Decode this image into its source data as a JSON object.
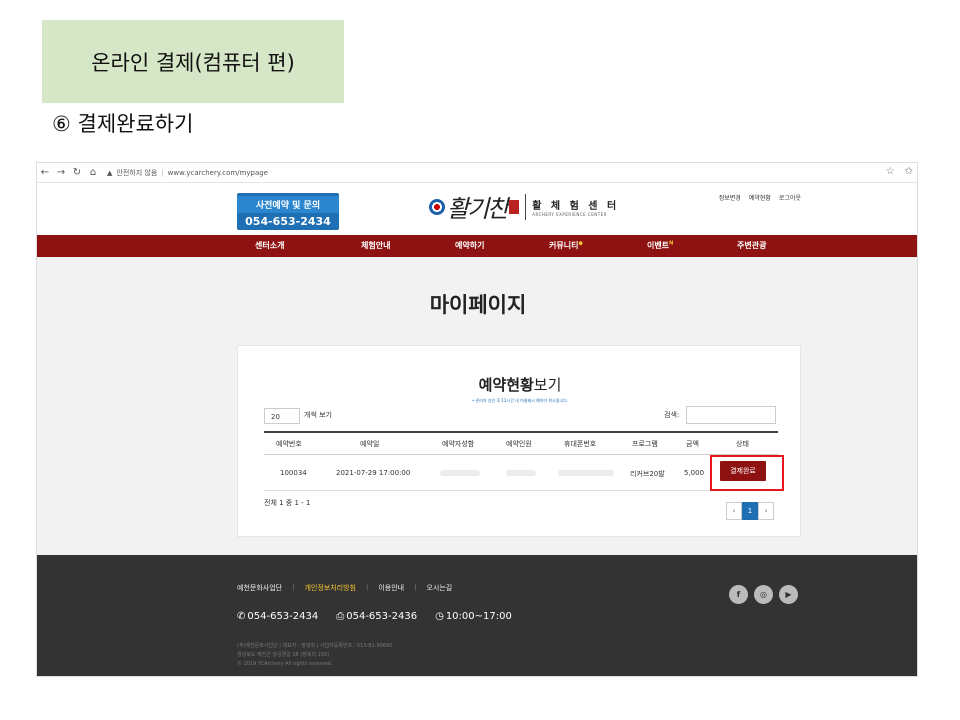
{
  "slide": {
    "title": "온라인 결제(컴퓨터 편)",
    "step": "⑥ 결제완료하기"
  },
  "browser": {
    "security": "안전하지 않음",
    "url": "www.ycarchery.com/mypage"
  },
  "header": {
    "contact_title": "사전예약 및 문의",
    "contact_phone": "054-653-2434",
    "logo_script": "활기찬",
    "brand_name": "활 체 험 센 터",
    "brand_sub": "ARCHERY EXPERIENCE CENTER",
    "links": [
      "정보변경",
      "예약현황",
      "로그아웃"
    ]
  },
  "menu": [
    "센터소개",
    "체험안내",
    "예약하기",
    "커뮤니티",
    "이벤트",
    "주변관광"
  ],
  "page_title": "마이페이지",
  "reservations": {
    "title_bold": "예약현황",
    "title_rest": "보기",
    "note": "• 관리자 승인 후 12시간 내 미결제시 예약이 취소됩니다.",
    "per_page": "20",
    "per_page_label": "개씩 보기",
    "search_label": "검색:",
    "columns": [
      "예약번호",
      "예약일",
      "예약자성함",
      "예약인원",
      "휴대폰번호",
      "프로그램",
      "금액",
      "상태"
    ],
    "rows": [
      {
        "id": "100034",
        "date": "2021-07-29 17:00:00",
        "program": "리커브20발",
        "amount": "5,000",
        "status": "결제완료"
      }
    ],
    "total": "전체 1 중 1 - 1",
    "pager": {
      "prev": "‹",
      "page": "1",
      "next": "›"
    }
  },
  "footer": {
    "links": [
      "예천문화사업단",
      "개인정보처리방침",
      "이용안내",
      "오시는길"
    ],
    "phone": "054-653-2434",
    "fax": "054-653-2436",
    "hours": "10:00~17:00",
    "info1": "(주)예천문화사업단 | 대표자 : 장영희 | 사업자등록번호 : 513-81-90690",
    "info2": "경상북도 예천군 양궁경길 38 (청복리 150)",
    "copyright": "© 2019 YCArchery All rights reserved."
  },
  "colors": {
    "brand_red": "#8e1212",
    "brand_blue": "#1f6fb5",
    "highlight": "#e8171f",
    "title_bg": "#d6e7c8"
  }
}
